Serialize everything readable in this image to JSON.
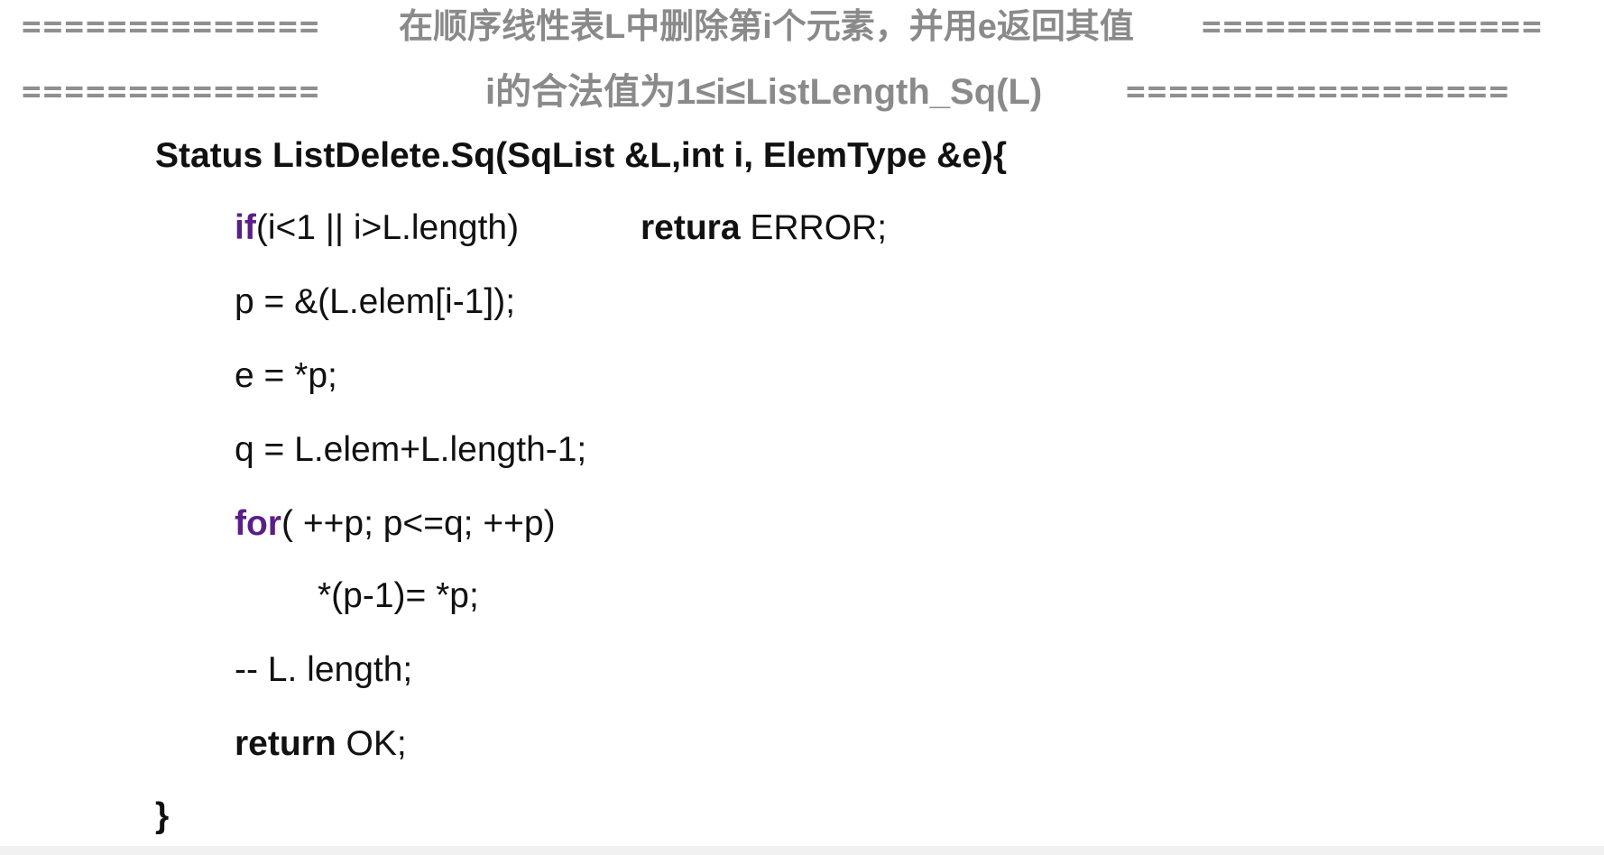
{
  "header": {
    "line1": {
      "left_rule": "==============",
      "title": "在顺序线性表L中删除第i个元素，并用e返回其值",
      "right_rule": "================"
    },
    "line2": {
      "left_rule": "==============",
      "note": "i的合法值为1≤i≤ListLength_Sq(L)",
      "right_rule": "=================="
    }
  },
  "code": {
    "signature": "Status ListDelete.Sq(SqList &L,int i, ElemType &e){",
    "if_kw": "if",
    "if_cond": "(i<1 || i>L.length)",
    "retura_kw": "retura",
    "retura_val": " ERROR;",
    "line_p": "p = &(L.elem[i-1]);",
    "line_e": "e = *p;",
    "line_q": "q = L.elem+L.length-1;",
    "for_kw": "for",
    "for_rest": "( ++p; p<=q; ++p)",
    "loop_body": "*(p-1)= *p;",
    "dec_len": "-- L. length;",
    "return_kw": "return",
    "return_val": " OK;",
    "close_brace": "}"
  },
  "colors": {
    "keyword_purple": "#5b1f87",
    "header_gray": "#8a8a8a",
    "text": "#111111"
  }
}
